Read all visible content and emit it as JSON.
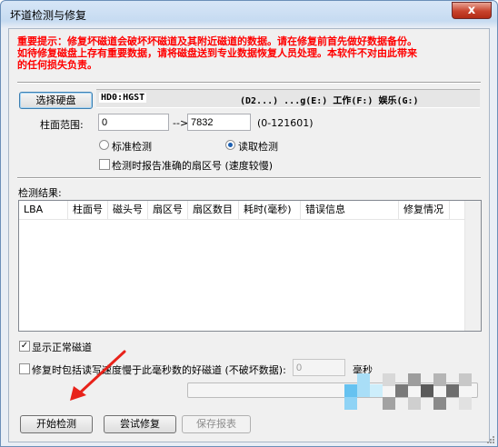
{
  "window": {
    "title": "坏道检测与修复",
    "close": "x"
  },
  "warning": {
    "line1": "重要提示：修复坏磁道会破坏坏磁道及其附近磁道的数据。请在修复前首先做好数据备份。",
    "line2": "如待修复磁盘上存有重要数据，请将磁盘送到专业数据恢复人员处理。本软件不对由此带来",
    "line3": "的任何损失负责。"
  },
  "disk": {
    "select_button": "选择硬盘",
    "name": "HD0:HGST",
    "partitions": "(D2...)    ...g(E:) 工作(F:) 娱乐(G:)"
  },
  "range": {
    "label": "柱面范围:",
    "start": "0",
    "arrow": "-->",
    "end": "7832",
    "hint": "(0-121601)"
  },
  "mode": {
    "standard": "标准检测",
    "read": "读取检测",
    "selected": "read"
  },
  "report_sector": {
    "label": "检测时报告准确的扇区号 (速度较慢)",
    "checked": false
  },
  "results": {
    "label": "检测结果:",
    "columns": [
      "LBA",
      "柱面号",
      "磁头号",
      "扇区号",
      "扇区数目",
      "耗时(毫秒)",
      "错误信息",
      "修复情况"
    ]
  },
  "show_normal": {
    "label": "显示正常磁道",
    "checked": true
  },
  "include_slow": {
    "label": "修复时包括读写速度慢于此毫秒数的好磁道 (不破坏数据):",
    "value": "0",
    "unit": "毫秒",
    "checked": false
  },
  "buttons": {
    "start": "开始检测",
    "repair": "尝试修复",
    "save": "保存报表"
  },
  "colors": {
    "warning": "#ff0000",
    "arrow": "#e8221a"
  }
}
